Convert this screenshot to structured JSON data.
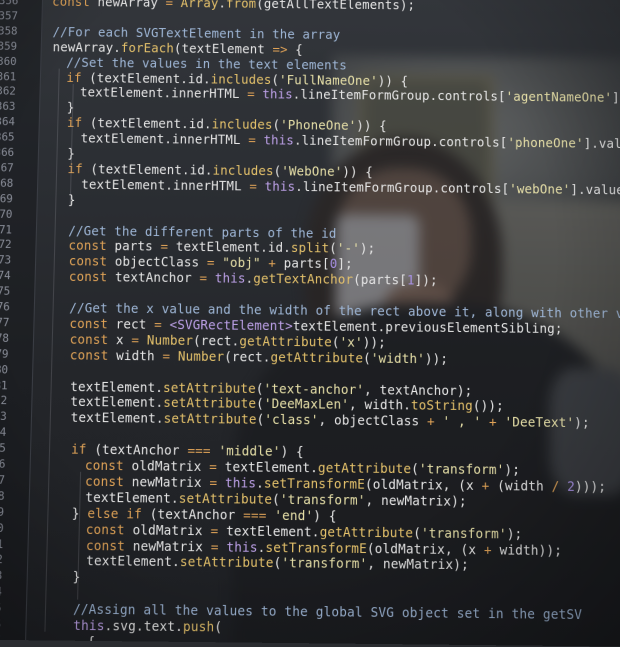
{
  "code_lines": [
    {
      "num": "356",
      "indent": 0,
      "parts": [
        [
          "k",
          "const "
        ],
        [
          "t",
          "newArray "
        ],
        [
          "k",
          "= "
        ],
        [
          "f",
          "Array"
        ],
        [
          "t",
          "."
        ],
        [
          "f",
          "from"
        ],
        [
          "t",
          "(getAllTextElements);"
        ]
      ]
    },
    {
      "num": "357",
      "indent": 0,
      "parts": []
    },
    {
      "num": "358",
      "indent": 0,
      "parts": [
        [
          "c",
          "//For each SVGTextElement in the array"
        ]
      ]
    },
    {
      "num": "359",
      "indent": 0,
      "parts": [
        [
          "t",
          "newArray."
        ],
        [
          "f",
          "forEach"
        ],
        [
          "t",
          "(textElement "
        ],
        [
          "k",
          "=> "
        ],
        [
          "t",
          "{"
        ]
      ]
    },
    {
      "num": "360",
      "indent": 1,
      "parts": [
        [
          "c",
          "//Set the values in the text elements"
        ]
      ]
    },
    {
      "num": "361",
      "indent": 1,
      "parts": [
        [
          "k",
          "if "
        ],
        [
          "t",
          "(textElement.id."
        ],
        [
          "f",
          "includes"
        ],
        [
          "t",
          "("
        ],
        [
          "s",
          "'FullNameOne'"
        ],
        [
          "t",
          ")) {"
        ]
      ]
    },
    {
      "num": "362",
      "indent": 2,
      "parts": [
        [
          "t",
          "textElement.innerHTML "
        ],
        [
          "k",
          "= "
        ],
        [
          "h",
          "this"
        ],
        [
          "t",
          ".lineItemFormGroup.controls["
        ],
        [
          "s",
          "'agentNameOne'"
        ],
        [
          "t",
          "].value;"
        ]
      ]
    },
    {
      "num": "363",
      "indent": 1,
      "parts": [
        [
          "t",
          "}"
        ]
      ]
    },
    {
      "num": "364",
      "indent": 1,
      "parts": [
        [
          "k",
          "if "
        ],
        [
          "t",
          "(textElement.id."
        ],
        [
          "f",
          "includes"
        ],
        [
          "t",
          "("
        ],
        [
          "s",
          "'PhoneOne'"
        ],
        [
          "t",
          ")) {"
        ]
      ]
    },
    {
      "num": "365",
      "indent": 2,
      "parts": [
        [
          "t",
          "textElement.innerHTML "
        ],
        [
          "k",
          "= "
        ],
        [
          "h",
          "this"
        ],
        [
          "t",
          ".lineItemFormGroup.controls["
        ],
        [
          "s",
          "'phoneOne'"
        ],
        [
          "t",
          "].value;"
        ]
      ]
    },
    {
      "num": "366",
      "indent": 1,
      "parts": [
        [
          "t",
          "}"
        ]
      ]
    },
    {
      "num": "367",
      "indent": 1,
      "parts": [
        [
          "k",
          "if "
        ],
        [
          "t",
          "(textElement.id."
        ],
        [
          "f",
          "includes"
        ],
        [
          "t",
          "("
        ],
        [
          "s",
          "'WebOne'"
        ],
        [
          "t",
          ")) {"
        ]
      ]
    },
    {
      "num": "368",
      "indent": 2,
      "parts": [
        [
          "t",
          "textElement.innerHTML "
        ],
        [
          "k",
          "= "
        ],
        [
          "h",
          "this"
        ],
        [
          "t",
          ".lineItemFormGroup.controls["
        ],
        [
          "s",
          "'webOne'"
        ],
        [
          "t",
          "].value;"
        ]
      ]
    },
    {
      "num": "369",
      "indent": 1,
      "parts": [
        [
          "t",
          "}"
        ]
      ]
    },
    {
      "num": "370",
      "indent": 0,
      "parts": []
    },
    {
      "num": "371",
      "indent": 1,
      "parts": [
        [
          "c",
          "//Get the different parts of the id"
        ]
      ]
    },
    {
      "num": "372",
      "indent": 1,
      "parts": [
        [
          "k",
          "const "
        ],
        [
          "t",
          "parts "
        ],
        [
          "k",
          "= "
        ],
        [
          "t",
          "textElement.id."
        ],
        [
          "f",
          "split"
        ],
        [
          "t",
          "("
        ],
        [
          "s",
          "'-'"
        ],
        [
          "t",
          ");"
        ]
      ]
    },
    {
      "num": "373",
      "indent": 1,
      "parts": [
        [
          "k",
          "const "
        ],
        [
          "t",
          "objectClass "
        ],
        [
          "k",
          "= "
        ],
        [
          "s",
          "\"obj\" "
        ],
        [
          "k",
          "+ "
        ],
        [
          "t",
          "parts["
        ],
        [
          "n",
          "0"
        ],
        [
          "t",
          "];"
        ]
      ]
    },
    {
      "num": "374",
      "indent": 1,
      "parts": [
        [
          "k",
          "const "
        ],
        [
          "t",
          "textAnchor "
        ],
        [
          "k",
          "= "
        ],
        [
          "h",
          "this"
        ],
        [
          "t",
          "."
        ],
        [
          "f",
          "getTextAnchor"
        ],
        [
          "t",
          "(parts["
        ],
        [
          "n",
          "1"
        ],
        [
          "t",
          "]);"
        ]
      ]
    },
    {
      "num": "375",
      "indent": 0,
      "parts": []
    },
    {
      "num": "376",
      "indent": 1,
      "parts": [
        [
          "c",
          "//Get the x value and the width of the rect above it, along with other values"
        ]
      ]
    },
    {
      "num": "377",
      "indent": 1,
      "parts": [
        [
          "k",
          "const "
        ],
        [
          "t",
          "rect "
        ],
        [
          "k",
          "= "
        ],
        [
          "h",
          "<SVGRectElement>"
        ],
        [
          "t",
          "textElement.previousElementSibling;"
        ]
      ]
    },
    {
      "num": "378",
      "indent": 1,
      "parts": [
        [
          "k",
          "const "
        ],
        [
          "t",
          "x "
        ],
        [
          "k",
          "= "
        ],
        [
          "f",
          "Number"
        ],
        [
          "t",
          "(rect."
        ],
        [
          "f",
          "getAttribute"
        ],
        [
          "t",
          "("
        ],
        [
          "s",
          "'x'"
        ],
        [
          "t",
          "));"
        ]
      ]
    },
    {
      "num": "379",
      "indent": 1,
      "parts": [
        [
          "k",
          "const "
        ],
        [
          "t",
          "width "
        ],
        [
          "k",
          "= "
        ],
        [
          "f",
          "Number"
        ],
        [
          "t",
          "(rect."
        ],
        [
          "f",
          "getAttribute"
        ],
        [
          "t",
          "("
        ],
        [
          "s",
          "'width'"
        ],
        [
          "t",
          "));"
        ]
      ]
    },
    {
      "num": "380",
      "indent": 0,
      "parts": []
    },
    {
      "num": "381",
      "indent": 1,
      "parts": [
        [
          "t",
          "textElement."
        ],
        [
          "f",
          "setAttribute"
        ],
        [
          "t",
          "("
        ],
        [
          "s",
          "'text-anchor'"
        ],
        [
          "t",
          ", textAnchor);"
        ]
      ]
    },
    {
      "num": "382",
      "indent": 1,
      "parts": [
        [
          "t",
          "textElement."
        ],
        [
          "f",
          "setAttribute"
        ],
        [
          "t",
          "("
        ],
        [
          "s",
          "'DeeMaxLen'"
        ],
        [
          "t",
          ", width."
        ],
        [
          "f",
          "toString"
        ],
        [
          "t",
          "());"
        ]
      ]
    },
    {
      "num": "383",
      "indent": 1,
      "parts": [
        [
          "t",
          "textElement."
        ],
        [
          "f",
          "setAttribute"
        ],
        [
          "t",
          "("
        ],
        [
          "s",
          "'class'"
        ],
        [
          "t",
          ", objectClass "
        ],
        [
          "k",
          "+ "
        ],
        [
          "s",
          "' , ' "
        ],
        [
          "k",
          "+ "
        ],
        [
          "s",
          "'DeeText'"
        ],
        [
          "t",
          ");"
        ]
      ]
    },
    {
      "num": "384",
      "indent": 0,
      "parts": []
    },
    {
      "num": "385",
      "indent": 1,
      "parts": [
        [
          "k",
          "if "
        ],
        [
          "t",
          "(textAnchor "
        ],
        [
          "k",
          "=== "
        ],
        [
          "s",
          "'middle'"
        ],
        [
          "t",
          ") {"
        ]
      ]
    },
    {
      "num": "386",
      "indent": 2,
      "parts": [
        [
          "k",
          "const "
        ],
        [
          "t",
          "oldMatrix "
        ],
        [
          "k",
          "= "
        ],
        [
          "t",
          "textElement."
        ],
        [
          "f",
          "getAttribute"
        ],
        [
          "t",
          "("
        ],
        [
          "s",
          "'transform'"
        ],
        [
          "t",
          ");"
        ]
      ]
    },
    {
      "num": "387",
      "indent": 2,
      "parts": [
        [
          "k",
          "const "
        ],
        [
          "t",
          "newMatrix "
        ],
        [
          "k",
          "= "
        ],
        [
          "h",
          "this"
        ],
        [
          "t",
          "."
        ],
        [
          "f",
          "setTransformE"
        ],
        [
          "t",
          "(oldMatrix, (x "
        ],
        [
          "k",
          "+ "
        ],
        [
          "t",
          "(width "
        ],
        [
          "k",
          "/ "
        ],
        [
          "n",
          "2"
        ],
        [
          "t",
          ")));"
        ]
      ]
    },
    {
      "num": "388",
      "indent": 2,
      "parts": [
        [
          "t",
          "textElement."
        ],
        [
          "f",
          "setAttribute"
        ],
        [
          "t",
          "("
        ],
        [
          "s",
          "'transform'"
        ],
        [
          "t",
          ", newMatrix);"
        ]
      ]
    },
    {
      "num": "389",
      "indent": 1,
      "parts": [
        [
          "t",
          "} "
        ],
        [
          "k",
          "else if "
        ],
        [
          "t",
          "(textAnchor "
        ],
        [
          "k",
          "=== "
        ],
        [
          "s",
          "'end'"
        ],
        [
          "t",
          ") {"
        ]
      ]
    },
    {
      "num": "390",
      "indent": 2,
      "parts": [
        [
          "k",
          "const "
        ],
        [
          "t",
          "oldMatrix "
        ],
        [
          "k",
          "= "
        ],
        [
          "t",
          "textElement."
        ],
        [
          "f",
          "getAttribute"
        ],
        [
          "t",
          "("
        ],
        [
          "s",
          "'transform'"
        ],
        [
          "t",
          ");"
        ]
      ]
    },
    {
      "num": "391",
      "indent": 2,
      "parts": [
        [
          "k",
          "const "
        ],
        [
          "t",
          "newMatrix "
        ],
        [
          "k",
          "= "
        ],
        [
          "h",
          "this"
        ],
        [
          "t",
          "."
        ],
        [
          "f",
          "setTransformE"
        ],
        [
          "t",
          "(oldMatrix, (x "
        ],
        [
          "k",
          "+ "
        ],
        [
          "t",
          "width));"
        ]
      ]
    },
    {
      "num": "392",
      "indent": 2,
      "parts": [
        [
          "t",
          "textElement."
        ],
        [
          "f",
          "setAttribute"
        ],
        [
          "t",
          "("
        ],
        [
          "s",
          "'transform'"
        ],
        [
          "t",
          ", newMatrix);"
        ]
      ]
    },
    {
      "num": "393",
      "indent": 1,
      "parts": [
        [
          "t",
          "}"
        ]
      ]
    },
    {
      "num": "394",
      "indent": 0,
      "parts": []
    },
    {
      "num": "395",
      "indent": 1,
      "parts": [
        [
          "c",
          "//Assign all the values to the global SVG object set in the getSV"
        ]
      ]
    },
    {
      "num": "396",
      "indent": 1,
      "parts": [
        [
          "h",
          "this"
        ],
        [
          "t",
          ".svg.text."
        ],
        [
          "f",
          "push"
        ],
        [
          "t",
          "("
        ]
      ]
    },
    {
      "num": "397",
      "indent": 2,
      "parts": [
        [
          "t",
          "{"
        ]
      ]
    }
  ],
  "colors": {
    "keyword": "#e0a357",
    "function": "#e5c26b",
    "string": "#e7e0a8",
    "comment": "#9fb7d7",
    "text": "#e6e6e6",
    "number": "#a992e6"
  }
}
